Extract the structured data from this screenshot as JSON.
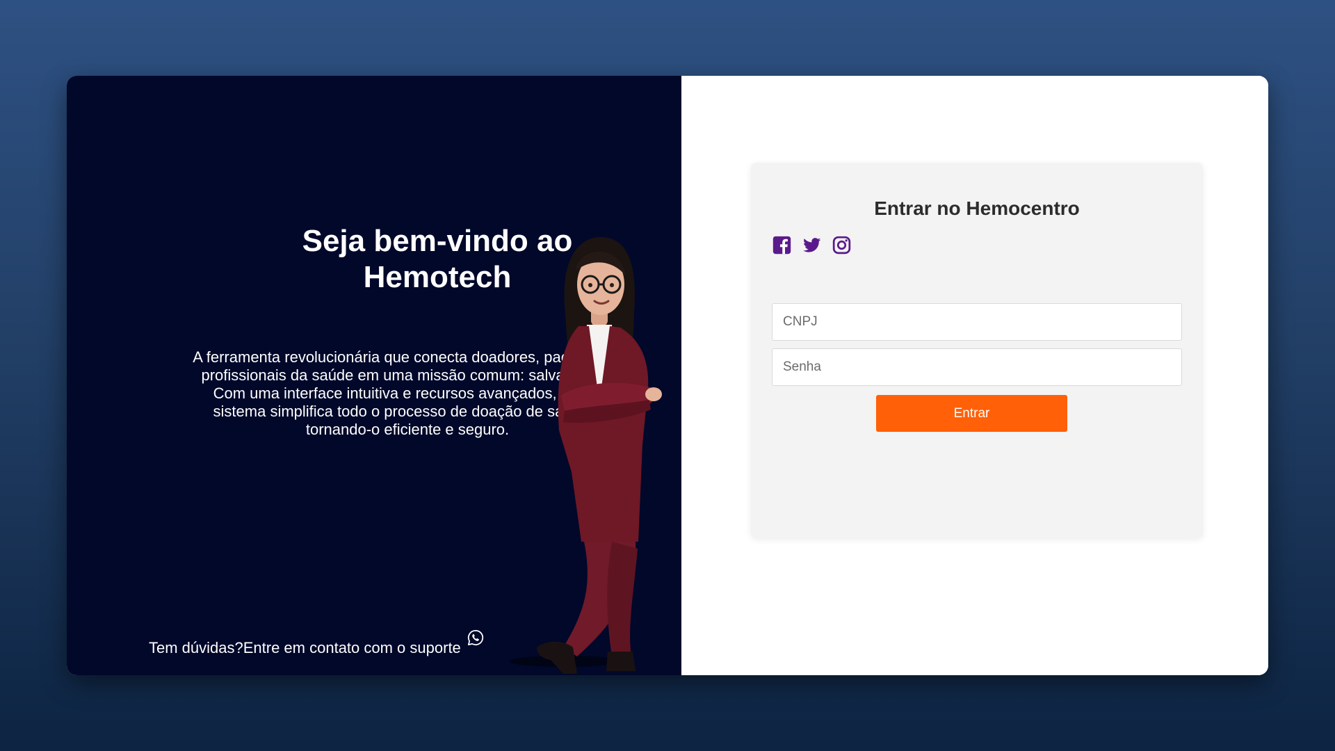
{
  "welcome": {
    "title": "Seja bem-vindo ao Hemotech",
    "description": "A ferramenta revolucionária que conecta doadores, pacientes e profissionais da saúde em uma missão comum: salvar vidas. Com uma interface intuitiva e recursos avançados, nosso sistema simplifica todo o processo de doação de sangue, tornando-o eficiente e seguro.",
    "support_text": "Tem dúvidas?Entre em contato com o suporte",
    "support_icon": "whatsapp-icon"
  },
  "login": {
    "title": "Entrar no Hemocentro",
    "social_icons": [
      "facebook-icon",
      "twitter-icon",
      "instagram-icon"
    ],
    "cnpj_placeholder": "CNPJ",
    "cnpj_value": "",
    "senha_placeholder": "Senha",
    "senha_value": "",
    "submit_label": "Entrar"
  },
  "colors": {
    "background_top": "#2e5183",
    "background_bottom": "#0d2442",
    "left_panel": "#01082a",
    "accent_button": "#ff6008",
    "social_icons": "#5b1a8c"
  }
}
